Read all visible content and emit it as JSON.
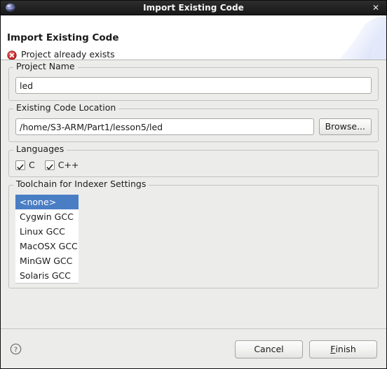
{
  "titlebar": {
    "title": "Import Existing Code",
    "app_icon": "eclipse-globe-icon",
    "close_label": "✕"
  },
  "header": {
    "title": "Import Existing Code",
    "status_icon": "error-icon",
    "status_message": "Project already exists",
    "background": "#ffffff"
  },
  "form": {
    "project_name": {
      "legend": "Project Name",
      "value": "led",
      "placeholder": ""
    },
    "existing_code_location": {
      "legend": "Existing Code Location",
      "value": "/home/S3-ARM/Part1/lesson5/led",
      "placeholder": "",
      "browse_label": "Browse..."
    },
    "languages": {
      "legend": "Languages",
      "options": [
        {
          "label": "C",
          "checked": true
        },
        {
          "label": "C++",
          "checked": true
        }
      ]
    },
    "toolchain": {
      "legend": "Toolchain for Indexer Settings",
      "items": [
        "<none>",
        "Cygwin GCC",
        "Linux GCC",
        "MacOSX GCC",
        "MinGW GCC",
        "Solaris GCC"
      ],
      "selected_index": 0,
      "selection_color": "#4a7ec4"
    }
  },
  "footer": {
    "help_icon": "help-question-icon",
    "cancel_label": "Cancel",
    "finish_mnemonic": "F",
    "finish_rest": "inish"
  },
  "colors": {
    "dialog_background": "#ececeb",
    "titlebar_background": "#232323",
    "error_red": "#cf2a2a",
    "selection_blue": "#4a7ec4"
  }
}
